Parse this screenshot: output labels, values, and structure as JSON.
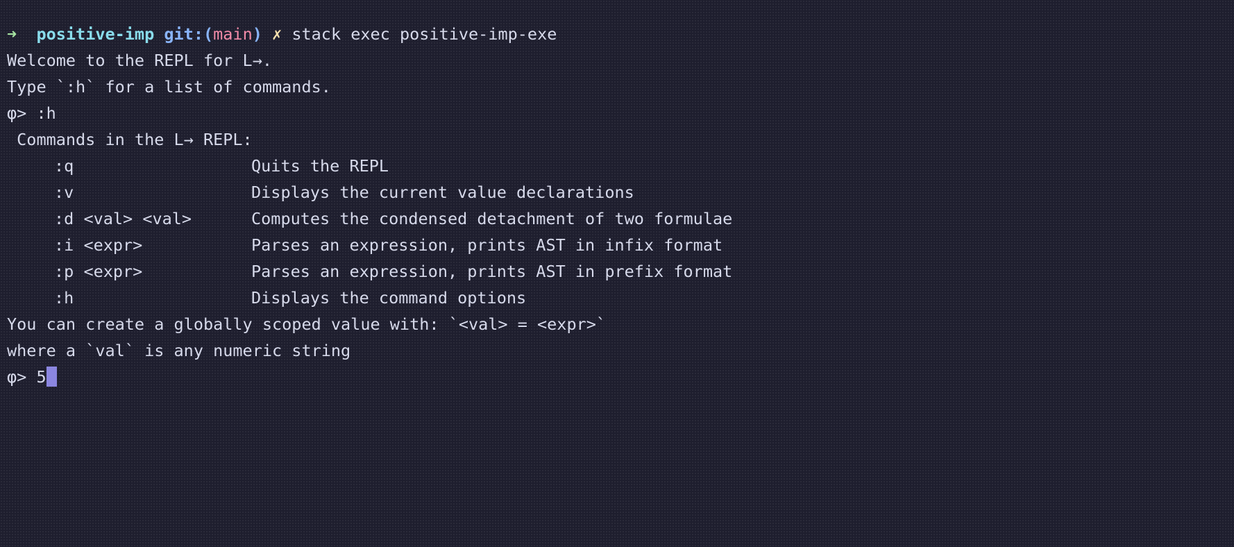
{
  "shell_prompt": {
    "arrow": "➜",
    "directory": "positive-imp",
    "git_prefix": "git:(",
    "branch": "main",
    "git_suffix": ")",
    "dirty_marker": "✗",
    "command": "stack exec positive-imp-exe"
  },
  "output": {
    "welcome": "Welcome to the REPL for L→.",
    "type_help": "Type `:h` for a list of commands."
  },
  "first_entry": {
    "prompt": "φ> ",
    "input": ":h"
  },
  "help": {
    "title": " Commands in the L→ REPL:",
    "commands": [
      {
        "cmd": ":q",
        "desc": "Quits the REPL"
      },
      {
        "cmd": ":v",
        "desc": "Displays the current value declarations"
      },
      {
        "cmd": ":d <val> <val>",
        "desc": "Computes the condensed detachment of two formulae"
      },
      {
        "cmd": ":i <expr>",
        "desc": "Parses an expression, prints AST in infix format"
      },
      {
        "cmd": ":p <expr>",
        "desc": "Parses an expression, prints AST in prefix format"
      },
      {
        "cmd": ":h",
        "desc": "Displays the command options"
      }
    ],
    "note_1": "You can create a globally scoped value with: `<val> = <expr>`",
    "note_2": "where a `val` is any numeric string"
  },
  "current_entry": {
    "prompt": "φ> ",
    "input": "5"
  }
}
